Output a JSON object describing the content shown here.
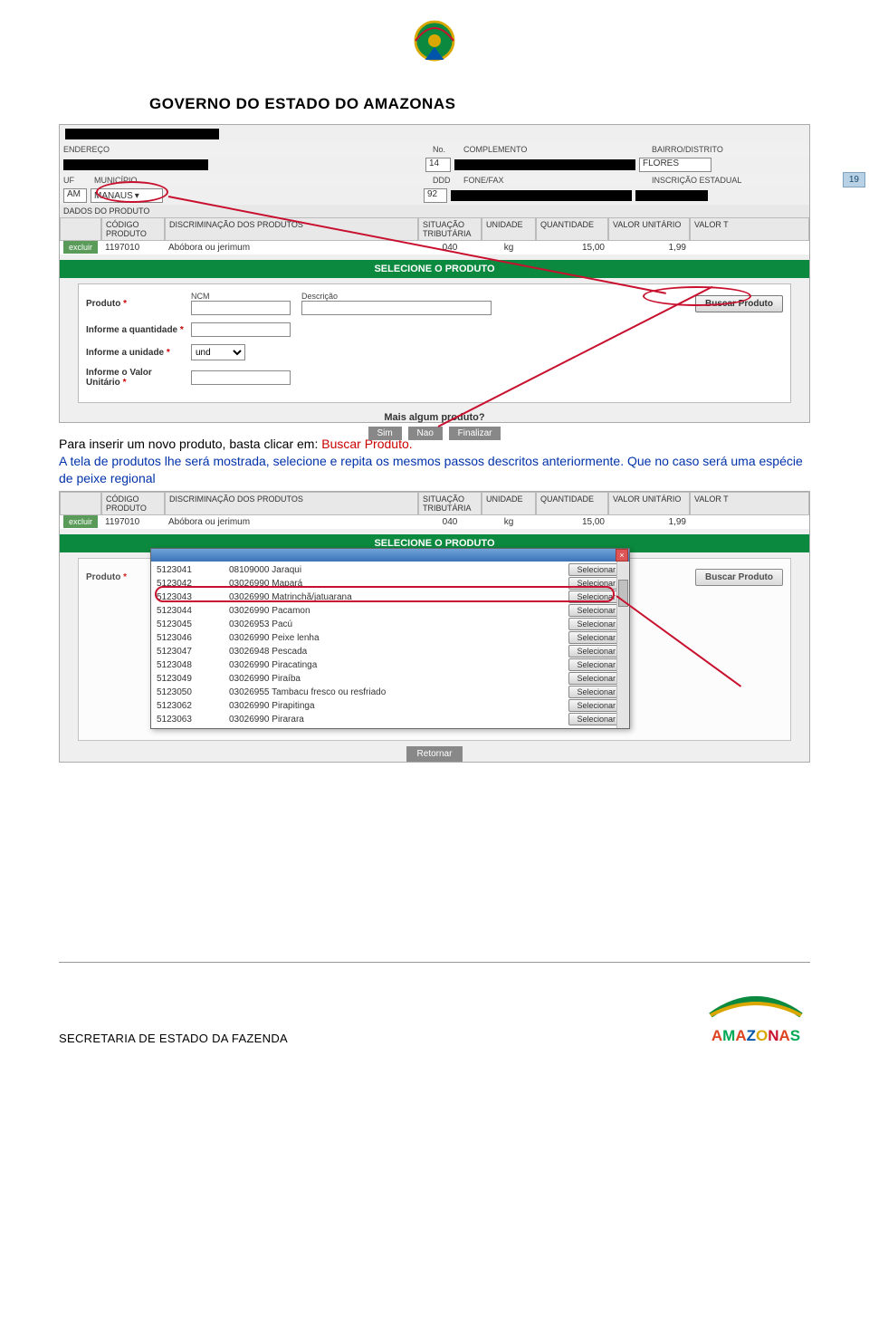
{
  "doc": {
    "title": "GOVERNO DO ESTADO DO AMAZONAS",
    "page_number": "19",
    "footer": "SECRETARIA DE ESTADO DA FAZENDA",
    "brand": "AMAZONAS"
  },
  "shot1": {
    "addr_labels": {
      "endereco": "ENDEREÇO",
      "no": "No.",
      "complemento": "COMPLEMENTO",
      "bairro": "BAIRRO/DISTRITO"
    },
    "addr_vals": {
      "no": "14",
      "bairro": "FLORES"
    },
    "loc_labels": {
      "uf": "UF",
      "municipio": "MUNICÍPIO",
      "ddd": "DDD",
      "fone": "FONE/FAX",
      "inscr": "INSCRIÇÃO ESTADUAL"
    },
    "loc_vals": {
      "uf": "AM",
      "municipio": "MANAUS",
      "ddd": "92"
    },
    "dados": "DADOS DO PRODUTO",
    "tbl": {
      "h_codigo": "CÓDIGO PRODUTO",
      "h_discr": "DISCRIMINAÇÃO DOS PRODUTOS",
      "h_sit": "SITUAÇÃO TRIBUTÁRIA",
      "h_unid": "UNIDADE",
      "h_qtd": "QUANTIDADE",
      "h_vu": "VALOR UNITÁRIO",
      "h_vt": "VALOR T",
      "excluir": "excluir",
      "codigo": "1197010",
      "discr": "Abóbora ou jerimum",
      "sit": "040",
      "unid": "kg",
      "qtd": "15,00",
      "vu": "1,99"
    },
    "band": "SELECIONE O PRODUTO",
    "panel": {
      "produto": "Produto",
      "ncm": "NCM",
      "desc": "Descrição",
      "buscar": "Buscar Produto",
      "qtd": "Informe a quantidade",
      "unid": "Informe a unidade",
      "unid_val": "und",
      "valor": "Informe o Valor Unitário"
    },
    "mais": "Mais algum produto?",
    "sim": "Sim",
    "nao": "Nao",
    "fin": "Finalizar"
  },
  "instruction": {
    "p1a": "Para inserir um novo produto, basta clicar em: ",
    "p1b": "Buscar Produto.",
    "p2": "A tela de produtos lhe será mostrada, selecione e repita os mesmos passos descritos anteriormente. Que no caso será uma espécie de peixe regional"
  },
  "shot2": {
    "popup_close": "×",
    "rows": [
      {
        "code": "5123041",
        "ncm": "08109000",
        "desc": "Jaraqui"
      },
      {
        "code": "5123042",
        "ncm": "03026990",
        "desc": "Mapará"
      },
      {
        "code": "5123043",
        "ncm": "03026990",
        "desc": "Matrinchã/jatuarana"
      },
      {
        "code": "5123044",
        "ncm": "03026990",
        "desc": "Pacamon"
      },
      {
        "code": "5123045",
        "ncm": "03026953",
        "desc": "Pacú"
      },
      {
        "code": "5123046",
        "ncm": "03026990",
        "desc": "Peixe lenha"
      },
      {
        "code": "5123047",
        "ncm": "03026948",
        "desc": "Pescada"
      },
      {
        "code": "5123048",
        "ncm": "03026990",
        "desc": "Piracatinga"
      },
      {
        "code": "5123049",
        "ncm": "03026990",
        "desc": "Piraíba"
      },
      {
        "code": "5123050",
        "ncm": "03026955",
        "desc": "Tambacu fresco ou resfriado"
      },
      {
        "code": "5123062",
        "ncm": "03026990",
        "desc": "Pirapitinga"
      },
      {
        "code": "5123063",
        "ncm": "03026990",
        "desc": "Pirarara"
      }
    ],
    "selecionar": "Selecionar",
    "retornar": "Retornar"
  }
}
